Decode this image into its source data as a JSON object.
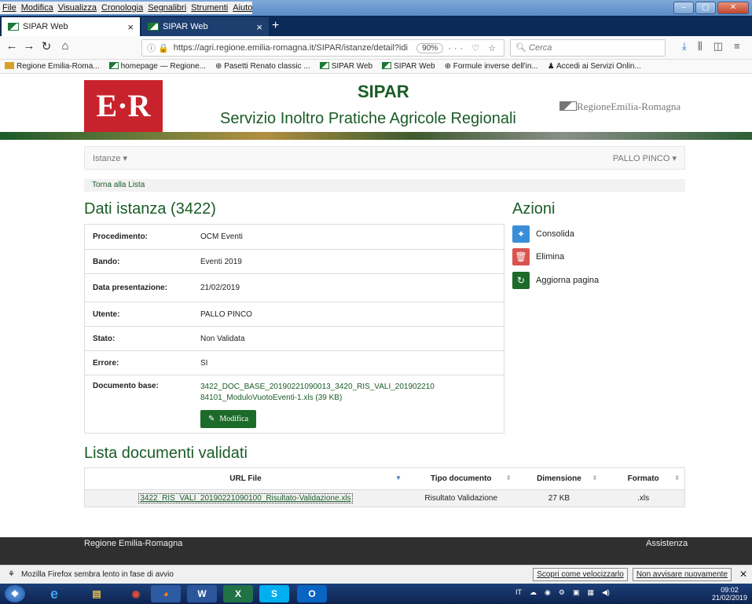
{
  "menubar": [
    "File",
    "Modifica",
    "Visualizza",
    "Cronologia",
    "Segnalibri",
    "Strumenti",
    "Aiuto"
  ],
  "tabs": [
    {
      "label": "SIPAR Web"
    },
    {
      "label": "SIPAR Web"
    }
  ],
  "url": "https://agri.regione.emilia-romagna.it/SIPAR/istanze/detail?idi",
  "zoom": "90%",
  "search_placeholder": "Cerca",
  "bookmarks": [
    "Regione Emilia-Roma...",
    "homepage — Regione...",
    "Pasetti Renato classic ...",
    "SIPAR Web",
    "SIPAR Web",
    "Formule inverse dell'in...",
    "Accedi ai Servizi Onlin..."
  ],
  "header": {
    "logo": "E·R",
    "title": "SIPAR",
    "subtitle": "Servizio Inoltro Pratiche Agricole Regionali",
    "region_logo": "RegioneEmilia-Romagna"
  },
  "nav": {
    "istanze": "Istanze ▾",
    "user": "PALLO PINCO ▾"
  },
  "breadcrumb": "Torna alla Lista",
  "dati": {
    "heading": "Dati istanza (3422)",
    "rows": [
      {
        "label": "Procedimento:",
        "value": "OCM Eventi"
      },
      {
        "label": "Bando:",
        "value": "Eventi 2019"
      },
      {
        "label": "Data presentazione:",
        "value": "21/02/2019"
      },
      {
        "label": "Utente:",
        "value": "PALLO PINCO"
      },
      {
        "label": "Stato:",
        "value": "Non Validata"
      },
      {
        "label": "Errore:",
        "value": "SI"
      }
    ],
    "doc_label": "Documento base:",
    "doc_line1": "3422_DOC_BASE_20190221090013_3420_RIS_VALI_201902210",
    "doc_line2": "84101_ModuloVuotoEventi-1.xls (39 KB)",
    "modifica": "Modifica"
  },
  "azioni": {
    "heading": "Azioni",
    "items": [
      {
        "label": "Consolida"
      },
      {
        "label": "Elimina"
      },
      {
        "label": "Aggiorna pagina"
      }
    ]
  },
  "lista": {
    "heading": "Lista documenti validati",
    "columns": [
      "URL File",
      "Tipo documento",
      "Dimensione",
      "Formato"
    ],
    "rows": [
      {
        "file": "3422_RIS_VALI_20190221090100_Risultato-Validazione.xls",
        "tipo": "Risultato Validazione",
        "dim": "27 KB",
        "formato": ".xls"
      }
    ]
  },
  "footer": {
    "left": "Regione Emilia-Romagna",
    "right": "Assistenza"
  },
  "notification": {
    "text": "Mozilla Firefox sembra lento in fase di avvio",
    "btn1": "Scopri come velocizzarlo",
    "btn2": "Non avvisare nuovamente"
  },
  "clock": {
    "time": "09:02",
    "date": "21/02/2019"
  }
}
